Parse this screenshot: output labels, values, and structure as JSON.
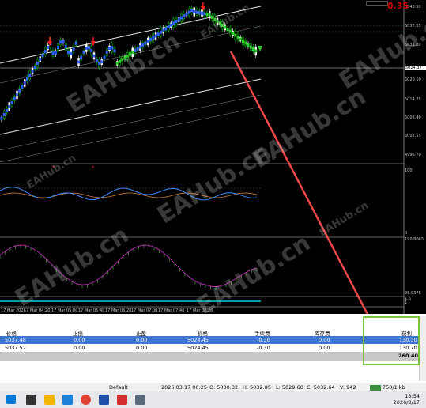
{
  "chart": {
    "price_labels": [
      "5043.50",
      "5037.65",
      "5031.80",
      "5020.10",
      "5014.25",
      "5008.40",
      "5002.55",
      "4996.70"
    ],
    "current_price": "5024.37",
    "osc1_labels": [
      "100",
      "0"
    ],
    "osc2_labels": [
      "190.8063",
      "26.9376"
    ],
    "osc3_labels": [
      "1.6",
      "1"
    ],
    "time_labels": [
      "17 Mar 2026",
      "17 Mar 04:20",
      "17 Mar 05:00",
      "17 Mar 05:40",
      "17 Mar 06:20",
      "17 Mar 07:00",
      "17 Mar 07:40",
      "17 Mar 08:20"
    ],
    "corner_badge": "0.35",
    "watermark": "EAHub.cn",
    "colors": {
      "bull": "#00c800",
      "bear": "#ffffff",
      "up_line": "#3060ff",
      "down_line": "#30d030",
      "arrow": "#ff2020",
      "trend_arrow": "#f04848"
    }
  },
  "terminal": {
    "columns": [
      "价格",
      "止损",
      "止盈",
      "价格",
      "手续费",
      "库存费",
      "获利"
    ],
    "rows": [
      {
        "open_price": "5037.48",
        "sl": "0.00",
        "tp": "0.00",
        "price": "5024.45",
        "commission": "-0.30",
        "swap": "0.00",
        "profit": "130.30",
        "selected": true
      },
      {
        "open_price": "5037.52",
        "sl": "0.00",
        "tp": "0.00",
        "price": "5024.45",
        "commission": "-0.30",
        "swap": "0.00",
        "profit": "130.70",
        "selected": false
      }
    ],
    "total_profit": "260.40"
  },
  "statusbar": {
    "profile": "Default",
    "datetime": "2026.03.17 06:25",
    "open": "O: 5030.32",
    "high": "H: 5032.85",
    "low": "L: 5029.60",
    "close": "C: 5032.64",
    "volume": "V: 942",
    "traffic": "750/1 kb"
  },
  "taskbar": {
    "time": "13:54",
    "date": "2026/3/17"
  }
}
